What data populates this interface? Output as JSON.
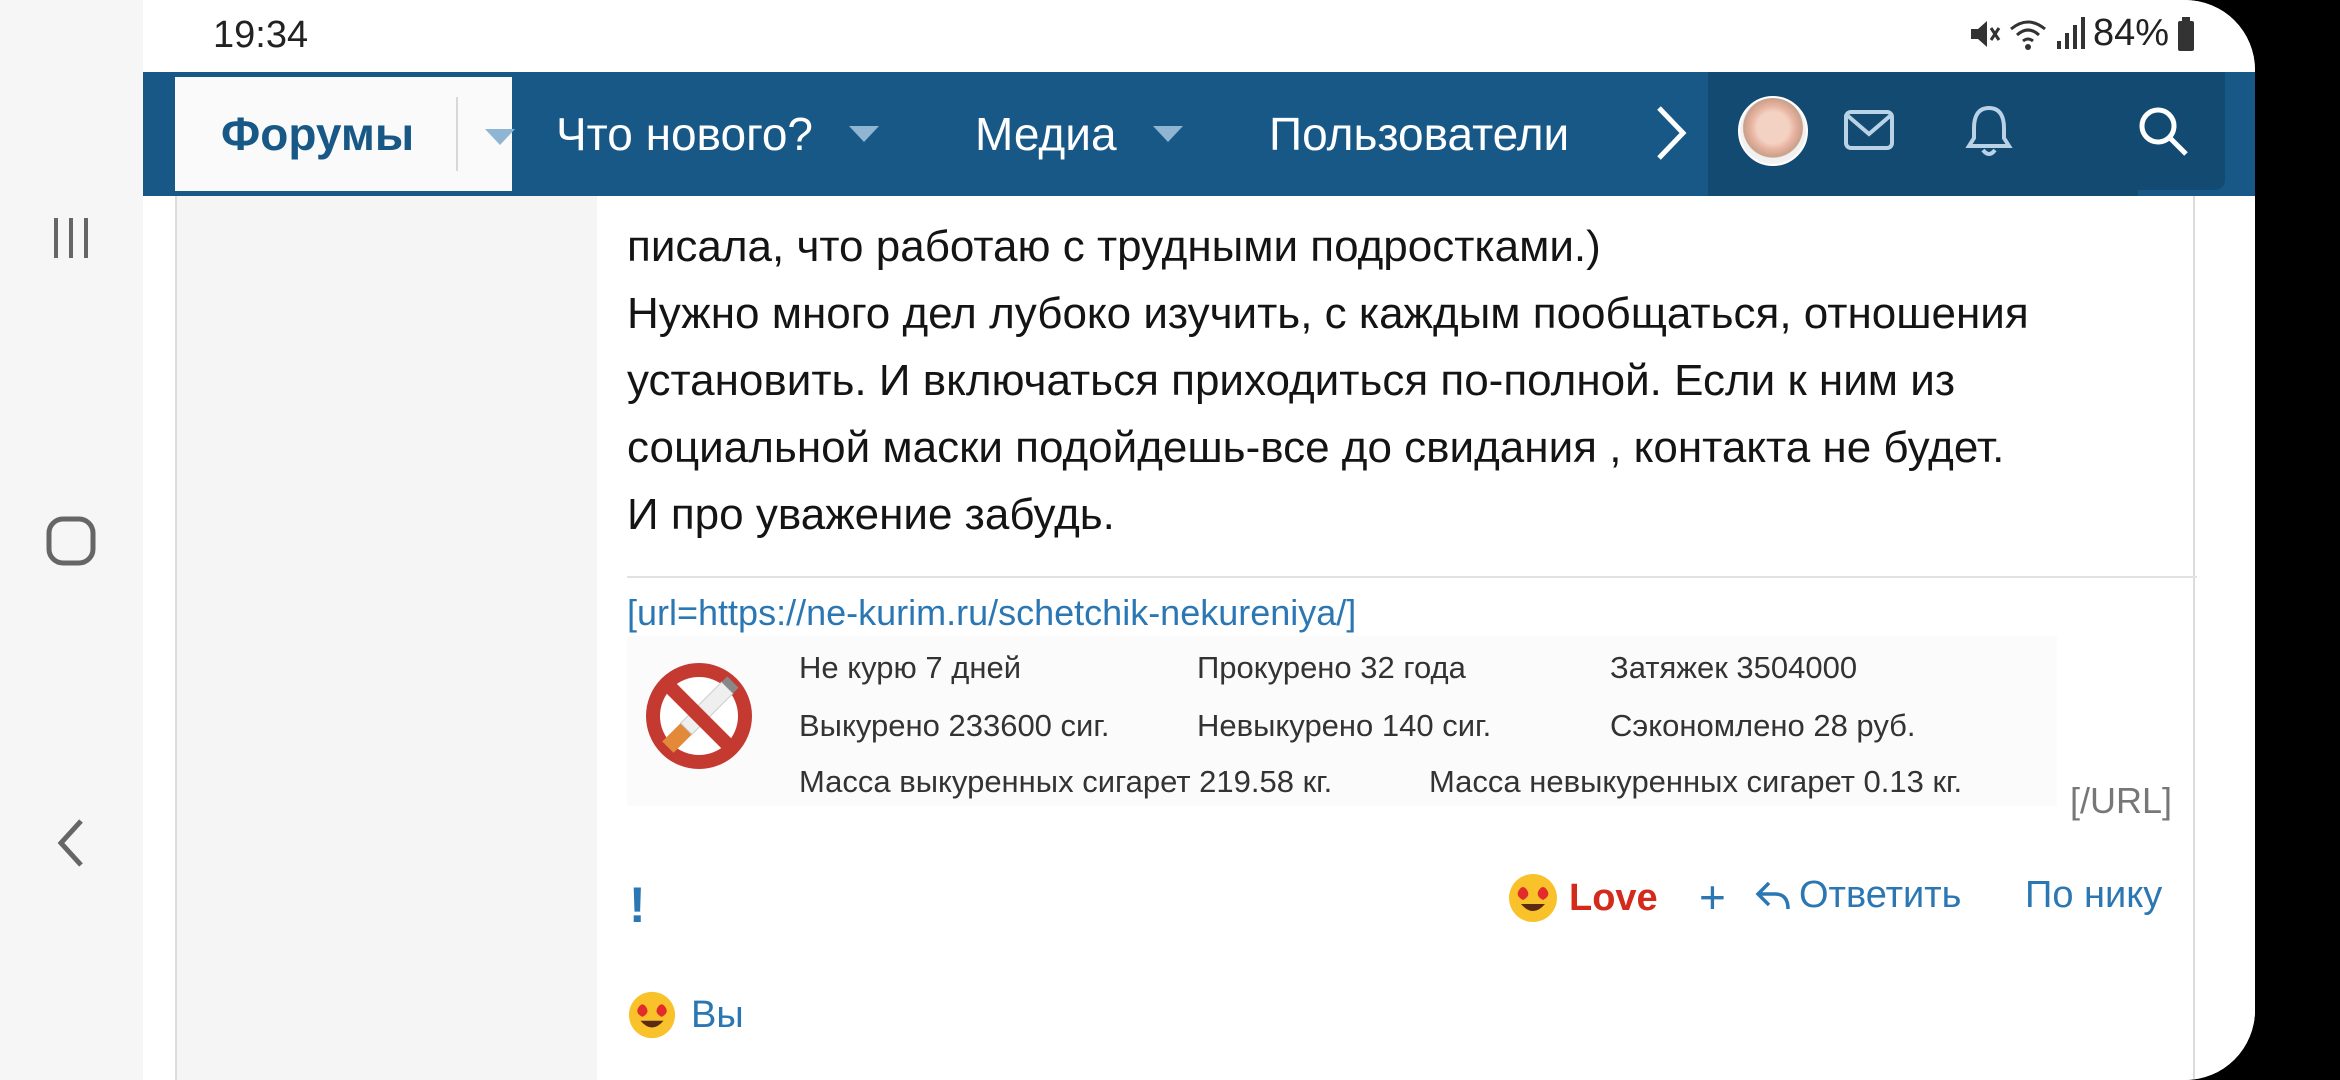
{
  "status": {
    "time": "19:34",
    "battery": "84%"
  },
  "nav": {
    "forums": "Форумы",
    "whats_new": "Что нового?",
    "media": "Медиа",
    "users": "Пользователи"
  },
  "post": {
    "lines": [
      "писала, что работаю с трудными подростками.)",
      "Нужно много дел лубоко изучить, с каждым пообщаться, отношения",
      "установить. И включаться приходиться по-полной. Если к ним из",
      "социальной маски подойдешь-все до свидания , контакта не будет.",
      "И про уважение забудь."
    ]
  },
  "signature": {
    "link_text": "[url=https://ne-kurim.ru/schetchik-nekureniya/]",
    "row1": [
      "Не курю 7 дней",
      "Прокурено 32 года",
      "Затяжек 3504000"
    ],
    "row2": [
      "Выкурено 233600 сиг.",
      "Невыкурено 140 сиг.",
      "Сэкономлено 28 руб."
    ],
    "row3": [
      "Масса выкуренных сигарет 219.58 кг.",
      "Масса невыкуренных сигарет 0.13 кг."
    ],
    "close_tag": "[/URL]"
  },
  "actions": {
    "warn": "!",
    "love": "Love",
    "plus": "+",
    "reply": "Ответить",
    "by_nick": "По нику"
  },
  "reactions": {
    "label": "Вы"
  },
  "colors": {
    "nav_bg": "#185886",
    "link": "#2b77b3",
    "love": "#d42a1c"
  }
}
